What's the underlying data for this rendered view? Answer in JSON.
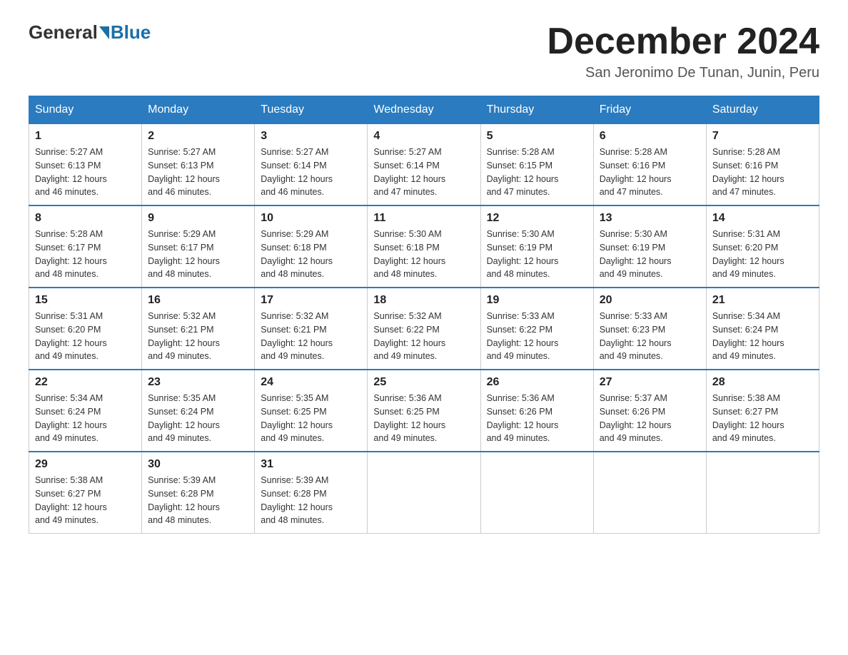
{
  "header": {
    "logo_general": "General",
    "logo_blue": "Blue",
    "title": "December 2024",
    "location": "San Jeronimo De Tunan, Junin, Peru"
  },
  "days_of_week": [
    "Sunday",
    "Monday",
    "Tuesday",
    "Wednesday",
    "Thursday",
    "Friday",
    "Saturday"
  ],
  "weeks": [
    [
      {
        "day": "1",
        "sunrise": "5:27 AM",
        "sunset": "6:13 PM",
        "daylight": "12 hours and 46 minutes."
      },
      {
        "day": "2",
        "sunrise": "5:27 AM",
        "sunset": "6:13 PM",
        "daylight": "12 hours and 46 minutes."
      },
      {
        "day": "3",
        "sunrise": "5:27 AM",
        "sunset": "6:14 PM",
        "daylight": "12 hours and 46 minutes."
      },
      {
        "day": "4",
        "sunrise": "5:27 AM",
        "sunset": "6:14 PM",
        "daylight": "12 hours and 47 minutes."
      },
      {
        "day": "5",
        "sunrise": "5:28 AM",
        "sunset": "6:15 PM",
        "daylight": "12 hours and 47 minutes."
      },
      {
        "day": "6",
        "sunrise": "5:28 AM",
        "sunset": "6:16 PM",
        "daylight": "12 hours and 47 minutes."
      },
      {
        "day": "7",
        "sunrise": "5:28 AM",
        "sunset": "6:16 PM",
        "daylight": "12 hours and 47 minutes."
      }
    ],
    [
      {
        "day": "8",
        "sunrise": "5:28 AM",
        "sunset": "6:17 PM",
        "daylight": "12 hours and 48 minutes."
      },
      {
        "day": "9",
        "sunrise": "5:29 AM",
        "sunset": "6:17 PM",
        "daylight": "12 hours and 48 minutes."
      },
      {
        "day": "10",
        "sunrise": "5:29 AM",
        "sunset": "6:18 PM",
        "daylight": "12 hours and 48 minutes."
      },
      {
        "day": "11",
        "sunrise": "5:30 AM",
        "sunset": "6:18 PM",
        "daylight": "12 hours and 48 minutes."
      },
      {
        "day": "12",
        "sunrise": "5:30 AM",
        "sunset": "6:19 PM",
        "daylight": "12 hours and 48 minutes."
      },
      {
        "day": "13",
        "sunrise": "5:30 AM",
        "sunset": "6:19 PM",
        "daylight": "12 hours and 49 minutes."
      },
      {
        "day": "14",
        "sunrise": "5:31 AM",
        "sunset": "6:20 PM",
        "daylight": "12 hours and 49 minutes."
      }
    ],
    [
      {
        "day": "15",
        "sunrise": "5:31 AM",
        "sunset": "6:20 PM",
        "daylight": "12 hours and 49 minutes."
      },
      {
        "day": "16",
        "sunrise": "5:32 AM",
        "sunset": "6:21 PM",
        "daylight": "12 hours and 49 minutes."
      },
      {
        "day": "17",
        "sunrise": "5:32 AM",
        "sunset": "6:21 PM",
        "daylight": "12 hours and 49 minutes."
      },
      {
        "day": "18",
        "sunrise": "5:32 AM",
        "sunset": "6:22 PM",
        "daylight": "12 hours and 49 minutes."
      },
      {
        "day": "19",
        "sunrise": "5:33 AM",
        "sunset": "6:22 PM",
        "daylight": "12 hours and 49 minutes."
      },
      {
        "day": "20",
        "sunrise": "5:33 AM",
        "sunset": "6:23 PM",
        "daylight": "12 hours and 49 minutes."
      },
      {
        "day": "21",
        "sunrise": "5:34 AM",
        "sunset": "6:24 PM",
        "daylight": "12 hours and 49 minutes."
      }
    ],
    [
      {
        "day": "22",
        "sunrise": "5:34 AM",
        "sunset": "6:24 PM",
        "daylight": "12 hours and 49 minutes."
      },
      {
        "day": "23",
        "sunrise": "5:35 AM",
        "sunset": "6:24 PM",
        "daylight": "12 hours and 49 minutes."
      },
      {
        "day": "24",
        "sunrise": "5:35 AM",
        "sunset": "6:25 PM",
        "daylight": "12 hours and 49 minutes."
      },
      {
        "day": "25",
        "sunrise": "5:36 AM",
        "sunset": "6:25 PM",
        "daylight": "12 hours and 49 minutes."
      },
      {
        "day": "26",
        "sunrise": "5:36 AM",
        "sunset": "6:26 PM",
        "daylight": "12 hours and 49 minutes."
      },
      {
        "day": "27",
        "sunrise": "5:37 AM",
        "sunset": "6:26 PM",
        "daylight": "12 hours and 49 minutes."
      },
      {
        "day": "28",
        "sunrise": "5:38 AM",
        "sunset": "6:27 PM",
        "daylight": "12 hours and 49 minutes."
      }
    ],
    [
      {
        "day": "29",
        "sunrise": "5:38 AM",
        "sunset": "6:27 PM",
        "daylight": "12 hours and 49 minutes."
      },
      {
        "day": "30",
        "sunrise": "5:39 AM",
        "sunset": "6:28 PM",
        "daylight": "12 hours and 48 minutes."
      },
      {
        "day": "31",
        "sunrise": "5:39 AM",
        "sunset": "6:28 PM",
        "daylight": "12 hours and 48 minutes."
      },
      null,
      null,
      null,
      null
    ]
  ],
  "label_sunrise": "Sunrise:",
  "label_sunset": "Sunset:",
  "label_daylight": "Daylight:"
}
